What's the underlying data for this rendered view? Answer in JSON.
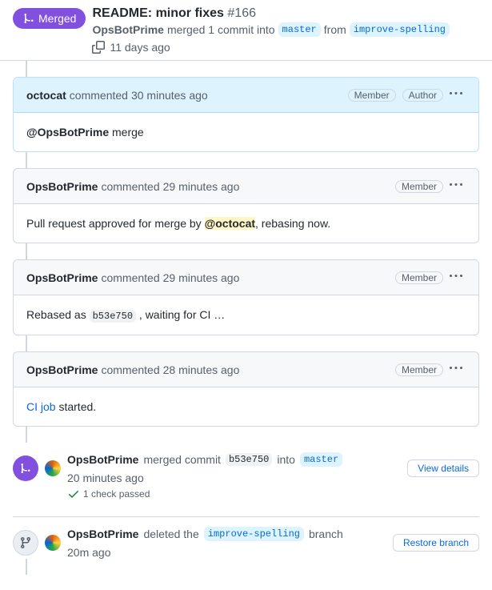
{
  "header": {
    "state": "Merged",
    "title": "README: minor fixes",
    "number": "#166",
    "actor": "OpsBotPrime",
    "merged_text": "merged 1 commit into",
    "base_branch": "master",
    "from_text": "from",
    "head_branch": "improve-spelling",
    "time": "11 days ago"
  },
  "comments": [
    {
      "user": "octocat",
      "verb": "commented",
      "time": "30 minutes ago",
      "badges": [
        "Member",
        "Author"
      ],
      "is_author": true,
      "body_html": "<span class='mention'>@OpsBotPrime</span> merge"
    },
    {
      "user": "OpsBotPrime",
      "verb": "commented",
      "time": "29 minutes ago",
      "badges": [
        "Member"
      ],
      "is_author": false,
      "body_html": "Pull request approved for merge by <span class='mention hl'>@octocat</span>, rebasing now."
    },
    {
      "user": "OpsBotPrime",
      "verb": "commented",
      "time": "29 minutes ago",
      "badges": [
        "Member"
      ],
      "is_author": false,
      "body_html": "Rebased as <span class='sha'>b53e750</span> , waiting for CI …"
    },
    {
      "user": "OpsBotPrime",
      "verb": "commented",
      "time": "28 minutes ago",
      "badges": [
        "Member"
      ],
      "is_author": false,
      "body_html": "<a href='#' class='link'>CI job</a> started."
    }
  ],
  "merge_event": {
    "user": "OpsBotPrime",
    "verb": "merged commit",
    "sha": "b53e750",
    "into": "into",
    "branch": "master",
    "time": "20 minutes ago",
    "view_details": "View details",
    "check": "1 check passed"
  },
  "delete_event": {
    "user": "OpsBotPrime",
    "verb": "deleted the",
    "branch": "improve-spelling",
    "suffix": "branch",
    "time": "20m ago",
    "restore": "Restore branch"
  }
}
